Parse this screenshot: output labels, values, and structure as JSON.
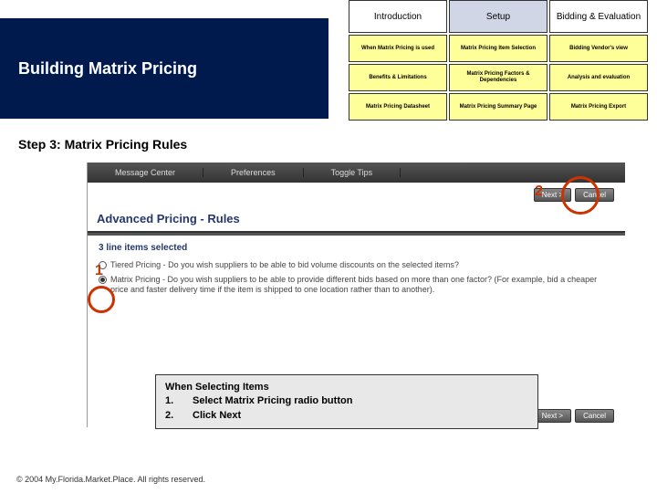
{
  "banner": {
    "title": "Building Matrix Pricing"
  },
  "tabs": {
    "a": "Introduction",
    "b": "Setup",
    "c": "Bidding & Evaluation"
  },
  "grid": {
    "r1c1": "When Matrix Pricing is used",
    "r1c2": "Matrix Pricing Item Selection",
    "r1c3": "Bidding Vendor's view",
    "r2c1": "Benefits & Limitations",
    "r2c2": "Matrix Pricing Factors & Dependencies",
    "r2c3": "Analysis and evaluation",
    "r3c1": "Matrix Pricing Datasheet",
    "r3c2": "Matrix Pricing Summary Page",
    "r3c3": "Matrix Pricing Export"
  },
  "step": {
    "title": "Step 3: Matrix Pricing Rules"
  },
  "ss_header": {
    "a": "Message Center",
    "b": "Preferences",
    "c": "Toggle Tips"
  },
  "buttons": {
    "next": "Next >",
    "cancel": "Cancel"
  },
  "markers": {
    "one": "1",
    "two": "2"
  },
  "panel": {
    "title": "Advanced Pricing - Rules",
    "count": "3 line items selected",
    "opt1": "Tiered Pricing - Do you wish suppliers to be able to bid volume discounts on the selected items?",
    "opt2": "Matrix Pricing - Do you wish suppliers to be able to provide different bids based on more than one factor? (For example, bid a cheaper price and faster delivery time if the item is shipped to one location rather than to another)."
  },
  "callout": {
    "title": "When Selecting Items",
    "l1": "Select Matrix Pricing radio button",
    "l2": "Click Next",
    "n1": "1.",
    "n2": "2."
  },
  "footer": {
    "copyright": "© 2004 My.Florida.Market.Place. All rights reserved."
  }
}
